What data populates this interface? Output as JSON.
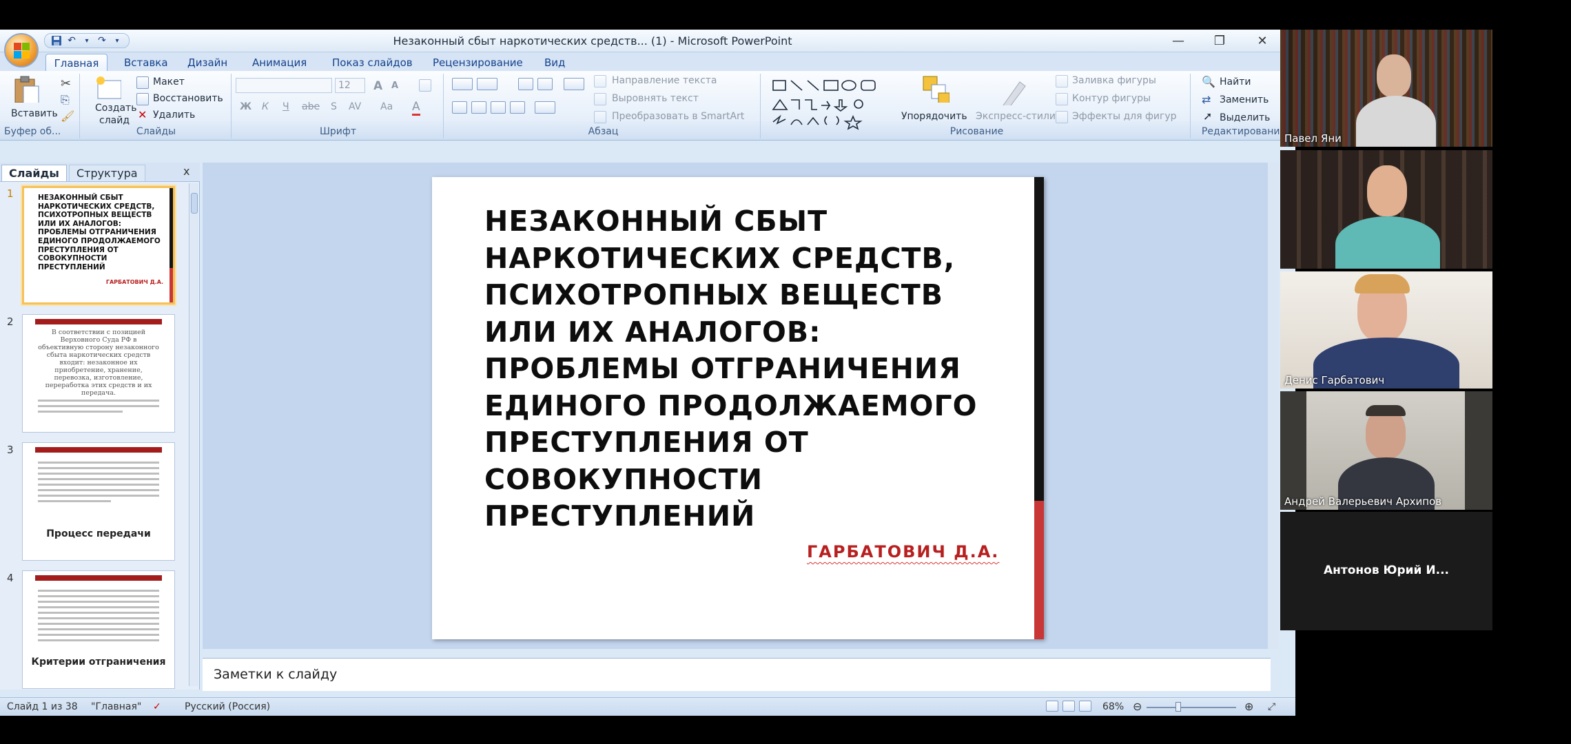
{
  "window": {
    "title": "Незаконный сбыт наркотических средств... (1) - Microsoft PowerPoint",
    "minimize": "—",
    "restore": "❐",
    "close": "✕"
  },
  "tabs": [
    "Главная",
    "Вставка",
    "Дизайн",
    "Анимация",
    "Показ слайдов",
    "Рецензирование",
    "Вид"
  ],
  "ribbon": {
    "clipboard": {
      "paste": "Вставить",
      "group": "Буфер об..."
    },
    "slides": {
      "create": "Создать",
      "create2": "слайд",
      "layout": "Макет",
      "reset": "Восстановить",
      "delete": "Удалить",
      "group": "Слайды"
    },
    "font": {
      "size": "12",
      "bold": "Ж",
      "italic": "К",
      "underline": "Ч",
      "strike": "abe",
      "shadow": "S",
      "spacing": "AV",
      "case": "Aa",
      "color": "A",
      "grow": "A",
      "shrink": "A",
      "group": "Шрифт"
    },
    "paragraph": {
      "direction": "Направление текста",
      "align": "Выровнять текст",
      "smartart": "Преобразовать в SmartArt",
      "group": "Абзац"
    },
    "drawing": {
      "arrange": "Упорядочить",
      "styles": "Экспресс-стили",
      "fill": "Заливка фигуры",
      "outline": "Контур фигуры",
      "effects": "Эффекты для фигур",
      "group": "Рисование"
    },
    "editing": {
      "find": "Найти",
      "replace": "Заменить",
      "select": "Выделить",
      "group": "Редактирование"
    }
  },
  "pane": {
    "tab_slides": "Слайды",
    "tab_outline": "Структура",
    "close": "x",
    "thumbs": [
      {
        "num": "1",
        "title": "НЕЗАКОННЫЙ СБЫТ НАРКОТИЧЕСКИХ СРЕДСТВ, ПСИХОТРОПНЫХ ВЕЩЕСТВ ИЛИ ИХ АНАЛОГОВ: ПРОБЛЕМЫ ОТГРАНИЧЕНИЯ ЕДИНОГО ПРОДОЛЖАЕМОГО ПРЕСТУПЛЕНИЯ ОТ СОВОКУПНОСТИ ПРЕСТУПЛЕНИЙ",
        "author": "ГАРБАТОВИЧ Д.А."
      },
      {
        "num": "2",
        "text": "В соответствии с позицией Верховного Суда РФ в объективную сторону незаконного сбыта наркотических средств входит: незаконное их приобретение, хранение, перевозка, изготовление, переработка этих средств и их передача."
      },
      {
        "num": "3",
        "caption": "Процесс передачи"
      },
      {
        "num": "4",
        "caption": "Критерии отграничения"
      }
    ]
  },
  "slide": {
    "title": "НЕЗАКОННЫЙ СБЫТ НАРКОТИЧЕСКИХ СРЕДСТВ, ПСИХОТРОПНЫХ ВЕЩЕСТВ ИЛИ ИХ АНАЛОГОВ: ПРОБЛЕМЫ ОТГРАНИЧЕНИЯ ЕДИНОГО ПРОДОЛЖАЕМОГО ПРЕСТУПЛЕНИЯ ОТ СОВОКУПНОСТИ ПРЕСТУПЛЕНИЙ",
    "author": "ГАРБАТОВИЧ Д.А.",
    "accent_dark": "#141414",
    "accent_red": "#c93636"
  },
  "notes": {
    "placeholder": "Заметки к слайду"
  },
  "status": {
    "slide": "Слайд 1 из 38",
    "theme": "\"Главная\"",
    "lang": "Русский (Россия)",
    "zoom": "68%"
  },
  "participants": [
    {
      "name": "Павел Яни"
    },
    {
      "name": ""
    },
    {
      "name": "Денис Гарбатович"
    },
    {
      "name": "Андрей Валерьевич Архипов"
    },
    {
      "name": "Антонов Юрий И..."
    }
  ]
}
